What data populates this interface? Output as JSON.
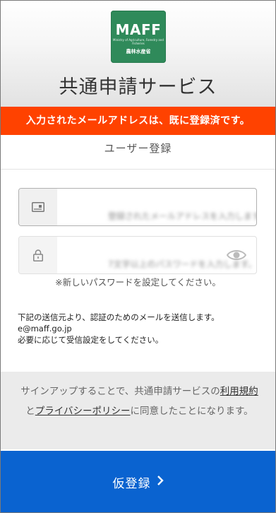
{
  "header": {
    "logo_text": "MAFF",
    "logo_subtext": "Ministry of Agriculture, Forestry and Fisheries",
    "logo_japanese": "農林水産省",
    "app_title": "共通申請サービス"
  },
  "error_banner": "入力されたメールアドレスは、既に登録済です。",
  "section_title": "ユーザー登録",
  "form": {
    "email": {
      "icon": "id-card-icon",
      "placeholder": "登録されたメールアドレスを入力します。"
    },
    "password": {
      "icon": "lock-icon",
      "placeholder": "7文字以上のパスワードを入力します。",
      "toggle_icon": "eye-icon"
    },
    "password_hint": "※新しいパスワードを設定してください。"
  },
  "notice": {
    "line1": "下記の送信元より、認証のためのメールを送信します。",
    "sender": "e@maff.go.jp",
    "line3": "必要に応じて受信設定をしてください。"
  },
  "terms": {
    "prefix": "サインアップすることで、共通申請サービスの",
    "terms_link": "利用規約",
    "conjunction": "と",
    "privacy_link": "プライバシーポリシー",
    "suffix": "に同意したことになります。"
  },
  "submit": {
    "label": "仮登録",
    "icon": "chevron-right-icon"
  },
  "colors": {
    "error": "#ff4200",
    "primary": "#0a63d0",
    "logo_green": "#2f8a5a"
  }
}
